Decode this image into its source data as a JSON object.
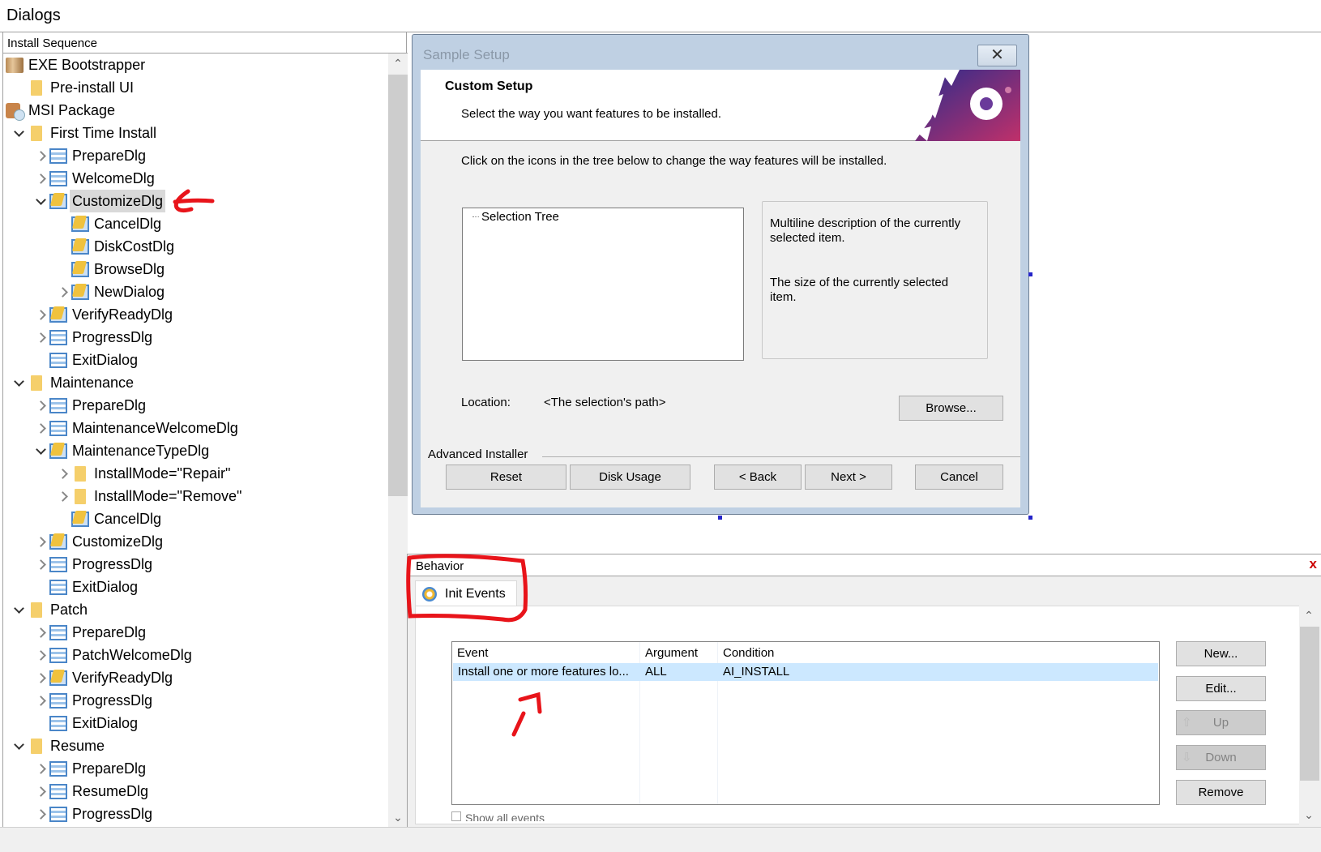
{
  "panel_title": "Dialogs",
  "sequence_header": "Install Sequence",
  "tree": [
    {
      "label": "EXE Bootstrapper",
      "level": 0,
      "icon": "box",
      "expander": "none"
    },
    {
      "label": "Pre-install UI",
      "level": 1,
      "icon": "folder",
      "expander": "none"
    },
    {
      "label": "MSI Package",
      "level": 0,
      "icon": "msi",
      "expander": "none"
    },
    {
      "label": "First Time Install",
      "level": 1,
      "icon": "folder",
      "expander": "expanded"
    },
    {
      "label": "PrepareDlg",
      "level": 2,
      "icon": "dlg",
      "expander": "collapsed"
    },
    {
      "label": "WelcomeDlg",
      "level": 2,
      "icon": "dlg",
      "expander": "collapsed"
    },
    {
      "label": "CustomizeDlg",
      "level": 2,
      "icon": "custom",
      "expander": "expanded",
      "selected": true
    },
    {
      "label": "CancelDlg",
      "level": 3,
      "icon": "custom",
      "expander": "none"
    },
    {
      "label": "DiskCostDlg",
      "level": 3,
      "icon": "custom",
      "expander": "none"
    },
    {
      "label": "BrowseDlg",
      "level": 3,
      "icon": "custom",
      "expander": "none"
    },
    {
      "label": "NewDialog",
      "level": 3,
      "icon": "custom",
      "expander": "collapsed"
    },
    {
      "label": "VerifyReadyDlg",
      "level": 2,
      "icon": "custom",
      "expander": "collapsed"
    },
    {
      "label": "ProgressDlg",
      "level": 2,
      "icon": "dlg",
      "expander": "collapsed"
    },
    {
      "label": "ExitDialog",
      "level": 2,
      "icon": "dlg",
      "expander": "none"
    },
    {
      "label": "Maintenance",
      "level": 1,
      "icon": "folder",
      "expander": "expanded"
    },
    {
      "label": "PrepareDlg",
      "level": 2,
      "icon": "dlg",
      "expander": "collapsed"
    },
    {
      "label": "MaintenanceWelcomeDlg",
      "level": 2,
      "icon": "dlg",
      "expander": "collapsed"
    },
    {
      "label": "MaintenanceTypeDlg",
      "level": 2,
      "icon": "custom",
      "expander": "expanded"
    },
    {
      "label": "InstallMode=\"Repair\"",
      "level": 3,
      "icon": "folder",
      "expander": "collapsed"
    },
    {
      "label": "InstallMode=\"Remove\"",
      "level": 3,
      "icon": "folder",
      "expander": "collapsed"
    },
    {
      "label": "CancelDlg",
      "level": 3,
      "icon": "custom",
      "expander": "none"
    },
    {
      "label": "CustomizeDlg",
      "level": 2,
      "icon": "custom",
      "expander": "collapsed"
    },
    {
      "label": "ProgressDlg",
      "level": 2,
      "icon": "dlg",
      "expander": "collapsed"
    },
    {
      "label": "ExitDialog",
      "level": 2,
      "icon": "dlg",
      "expander": "none"
    },
    {
      "label": "Patch",
      "level": 1,
      "icon": "folder",
      "expander": "expanded"
    },
    {
      "label": "PrepareDlg",
      "level": 2,
      "icon": "dlg",
      "expander": "collapsed"
    },
    {
      "label": "PatchWelcomeDlg",
      "level": 2,
      "icon": "dlg",
      "expander": "collapsed"
    },
    {
      "label": "VerifyReadyDlg",
      "level": 2,
      "icon": "custom",
      "expander": "collapsed"
    },
    {
      "label": "ProgressDlg",
      "level": 2,
      "icon": "dlg",
      "expander": "collapsed"
    },
    {
      "label": "ExitDialog",
      "level": 2,
      "icon": "dlg",
      "expander": "none"
    },
    {
      "label": "Resume",
      "level": 1,
      "icon": "folder",
      "expander": "expanded"
    },
    {
      "label": "PrepareDlg",
      "level": 2,
      "icon": "dlg",
      "expander": "collapsed"
    },
    {
      "label": "ResumeDlg",
      "level": 2,
      "icon": "dlg",
      "expander": "collapsed"
    },
    {
      "label": "ProgressDlg",
      "level": 2,
      "icon": "dlg",
      "expander": "collapsed"
    }
  ],
  "dialog": {
    "window_title": "Sample Setup",
    "heading": "Custom Setup",
    "subheading": "Select the way you want features to be installed.",
    "instruction": "Click on the icons in the tree below to change the way features will be installed.",
    "selection_tree_root": "Selection Tree",
    "description_text": "Multiline description of the currently selected item.",
    "size_text": "The size of the currently selected item.",
    "location_label": "Location:",
    "location_value": "<The selection's path>",
    "browse_button": "Browse...",
    "group_label": "Advanced Installer",
    "buttons": {
      "reset": "Reset",
      "disk_usage": "Disk Usage",
      "back": "< Back",
      "next": "Next >",
      "cancel": "Cancel"
    }
  },
  "behavior": {
    "title": "Behavior",
    "close": "x",
    "tab_label": "Init Events",
    "columns": [
      "Event",
      "Argument",
      "Condition"
    ],
    "rows": [
      {
        "event": "Install one or more features lo...",
        "argument": "ALL",
        "condition": "AI_INSTALL"
      }
    ],
    "buttons": {
      "new": "New...",
      "edit": "Edit...",
      "up": "Up",
      "down": "Down",
      "remove": "Remove"
    },
    "show_all_events": "Show all events"
  },
  "colors": {
    "selection_row": "#cce8ff",
    "annotation": "#e8141a",
    "dialog_frame": "#bfd0e3"
  }
}
